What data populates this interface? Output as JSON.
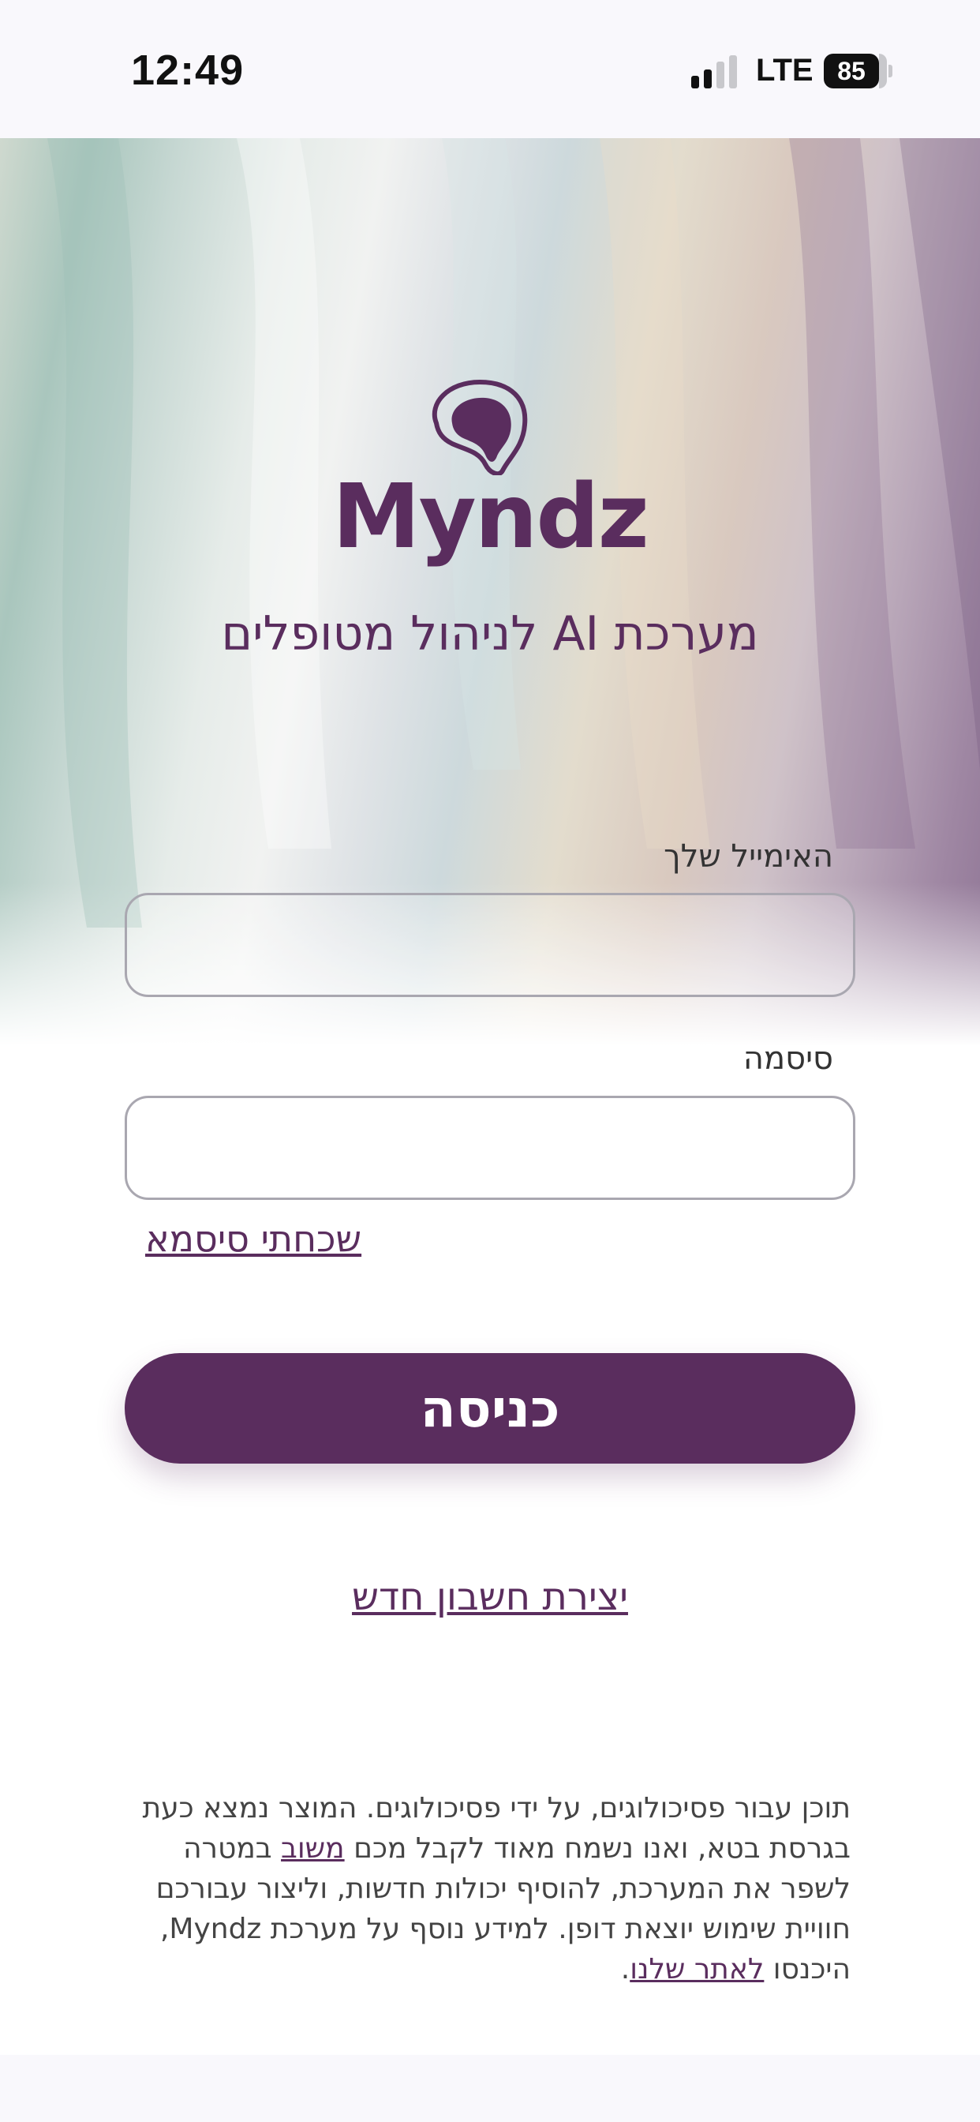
{
  "status_bar": {
    "time": "12:49",
    "network": "LTE",
    "battery": "85"
  },
  "brand": {
    "logo_icon": "brain-icon",
    "name": "Myndz",
    "tagline": "מערכת AI לניהול מטופלים"
  },
  "form": {
    "email_label": "האימייל שלך",
    "email_value": "",
    "password_label": "סיסמה",
    "password_value": "",
    "forgot_password": "שכחתי סיסמא",
    "login_button": "כניסה",
    "signup_link": "יצירת חשבון חדש"
  },
  "disclaimer": {
    "text_part1": "תוכן עבור פסיכולוגים, על ידי פסיכולוגים. המוצר נמצא כעת בגרסת בטא, ואנו נשמח מאוד לקבל מכם ",
    "feedback_link": "משוב",
    "text_part2": " במטרה לשפר את המערכת, להוסיף יכולות חדשות, וליצור עבורכם חוויית שימוש יוצאת דופן. למידע נוסף על מערכת Myndz, היכנסו ",
    "site_link": "לאתר שלנו",
    "text_end": "."
  },
  "colors": {
    "brand_purple": "#5a2d5e",
    "input_border": "#a9a7b0",
    "background": "#ffffff"
  }
}
